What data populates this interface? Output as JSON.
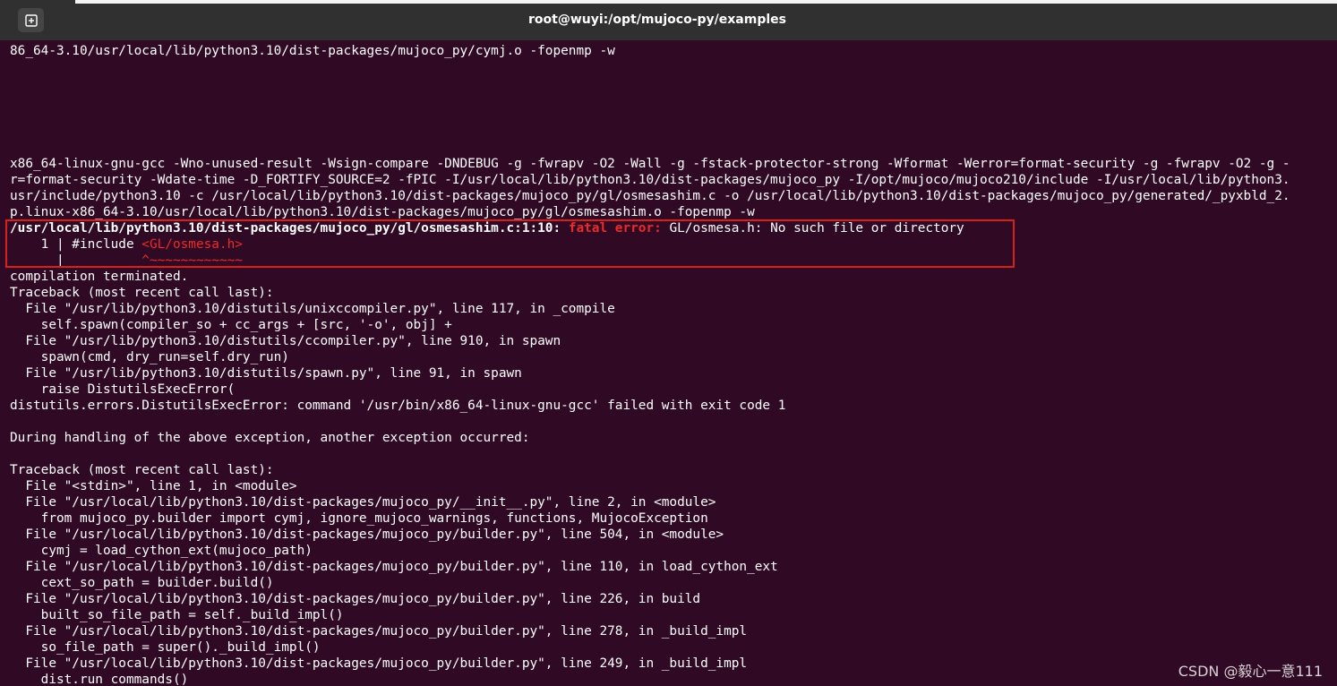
{
  "window": {
    "title": "root@wuyi:/opt/mujoco-py/examples"
  },
  "icons": {
    "new_tab": "new-tab-plus-icon"
  },
  "colors": {
    "terminal_bg": "#300a24",
    "titlebar_bg": "#303030",
    "error_red": "#ef2929",
    "highlight_box": "#d91e1e"
  },
  "terminal": {
    "lines": [
      "86_64-3.10/usr/local/lib/python3.10/dist-packages/mujoco_py/cymj.o -fopenmp -w",
      "",
      "",
      "",
      "",
      "",
      "",
      "x86_64-linux-gnu-gcc -Wno-unused-result -Wsign-compare -DNDEBUG -g -fwrapv -O2 -Wall -g -fstack-protector-strong -Wformat -Werror=format-security -g -fwrapv -O2 -g -",
      "r=format-security -Wdate-time -D_FORTIFY_SOURCE=2 -fPIC -I/usr/local/lib/python3.10/dist-packages/mujoco_py -I/opt/mujoco/mujoco210/include -I/usr/local/lib/python3.",
      "usr/include/python3.10 -c /usr/local/lib/python3.10/dist-packages/mujoco_py/gl/osmesashim.c -o /usr/local/lib/python3.10/dist-packages/mujoco_py/generated/_pyxbld_2.",
      "p.linux-x86_64-3.10/usr/local/lib/python3.10/dist-packages/mujoco_py/gl/osmesashim.o -fopenmp -w"
    ],
    "error": {
      "location": "/usr/local/lib/python3.10/dist-packages/mujoco_py/gl/osmesashim.c:1:10:",
      "label": "fatal error:",
      "message": "GL/osmesa.h: No such file or directory",
      "source_prefix": "    1 | #include ",
      "source_highlight": "<GL/osmesa.h>",
      "caret_prefix": "      |          ",
      "caret": "^~~~~~~~~~~~~"
    },
    "lines_after": [
      "compilation terminated.",
      "Traceback (most recent call last):",
      "  File \"/usr/lib/python3.10/distutils/unixccompiler.py\", line 117, in _compile",
      "    self.spawn(compiler_so + cc_args + [src, '-o', obj] +",
      "  File \"/usr/lib/python3.10/distutils/ccompiler.py\", line 910, in spawn",
      "    spawn(cmd, dry_run=self.dry_run)",
      "  File \"/usr/lib/python3.10/distutils/spawn.py\", line 91, in spawn",
      "    raise DistutilsExecError(",
      "distutils.errors.DistutilsExecError: command '/usr/bin/x86_64-linux-gnu-gcc' failed with exit code 1",
      "",
      "During handling of the above exception, another exception occurred:",
      "",
      "Traceback (most recent call last):",
      "  File \"<stdin>\", line 1, in <module>",
      "  File \"/usr/local/lib/python3.10/dist-packages/mujoco_py/__init__.py\", line 2, in <module>",
      "    from mujoco_py.builder import cymj, ignore_mujoco_warnings, functions, MujocoException",
      "  File \"/usr/local/lib/python3.10/dist-packages/mujoco_py/builder.py\", line 504, in <module>",
      "    cymj = load_cython_ext(mujoco_path)",
      "  File \"/usr/local/lib/python3.10/dist-packages/mujoco_py/builder.py\", line 110, in load_cython_ext",
      "    cext_so_path = builder.build()",
      "  File \"/usr/local/lib/python3.10/dist-packages/mujoco_py/builder.py\", line 226, in build",
      "    built_so_file_path = self._build_impl()",
      "  File \"/usr/local/lib/python3.10/dist-packages/mujoco_py/builder.py\", line 278, in _build_impl",
      "    so_file_path = super()._build_impl()",
      "  File \"/usr/local/lib/python3.10/dist-packages/mujoco_py/builder.py\", line 249, in _build_impl",
      "    dist.run_commands()"
    ]
  },
  "watermark": {
    "text": "CSDN @毅心一意111"
  }
}
